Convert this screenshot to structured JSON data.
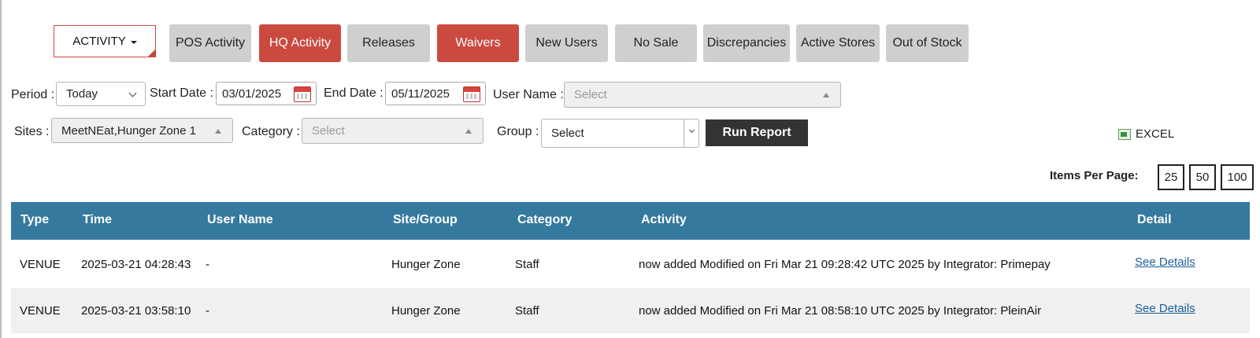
{
  "nav": {
    "activity_label": "ACTIVITY",
    "buttons": [
      {
        "label": "POS Activity",
        "active": false
      },
      {
        "label": "HQ Activity",
        "active": true
      },
      {
        "label": "Releases",
        "active": false
      },
      {
        "label": "Waivers",
        "active": true
      },
      {
        "label": "New Users",
        "active": false
      },
      {
        "label": "No Sale",
        "active": false
      },
      {
        "label": "Discrepancies",
        "active": false
      },
      {
        "label": "Active Stores",
        "active": false
      },
      {
        "label": "Out of Stock",
        "active": false
      }
    ]
  },
  "filters": {
    "period_label": "Period :",
    "period_value": "Today",
    "start_label": "Start Date :",
    "start_value": "03/01/2025",
    "end_label": "End Date :",
    "end_value": "05/11/2025",
    "username_label": "User Name :",
    "username_placeholder": "Select",
    "sites_label": "Sites :",
    "sites_value": "MeetNEat,Hunger Zone 1",
    "category_label": "Category :",
    "category_placeholder": "Select",
    "group_label": "Group :",
    "group_value": "Select",
    "run_label": "Run Report",
    "excel_label": "EXCEL"
  },
  "pagination": {
    "label": "Items Per Page:",
    "options": [
      "25",
      "50",
      "100"
    ]
  },
  "table": {
    "headers": [
      "Type",
      "Time",
      "User Name",
      "Site/Group",
      "Category",
      "Activity",
      "Detail"
    ],
    "rows": [
      [
        "VENUE",
        "2025-03-21 04:28:43",
        "-",
        "Hunger Zone",
        "Staff",
        "now added Modified on Fri Mar 21 09:28:42 UTC 2025 by Integrator: Primepay",
        "See Details"
      ],
      [
        "VENUE",
        "2025-03-21 03:58:10",
        "-",
        "Hunger Zone",
        "Staff",
        "now added Modified on Fri Mar 21 08:58:10 UTC 2025 by Integrator: PleinAir",
        "See Details"
      ]
    ]
  },
  "colors": {
    "accent_red": "#cb4a40",
    "header_blue": "#35799e",
    "button_gray": "#cfcfcf",
    "run_button": "#333333",
    "link": "#1a5e9a"
  }
}
